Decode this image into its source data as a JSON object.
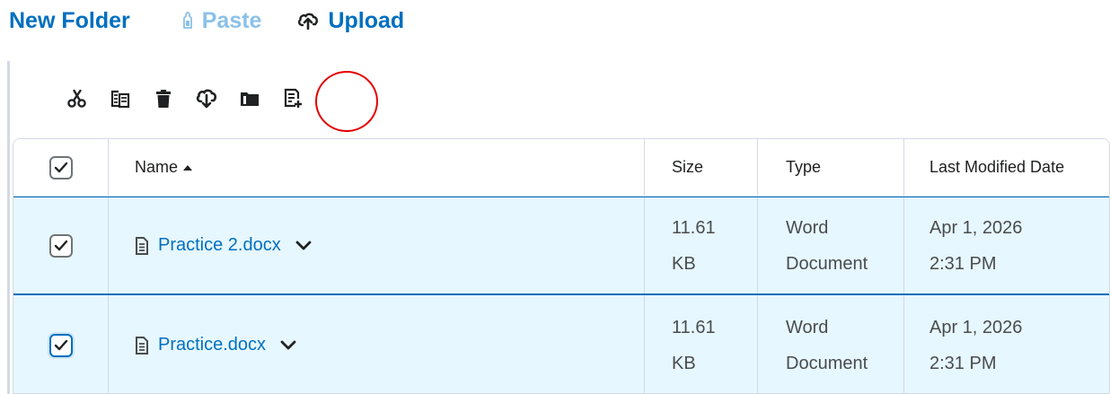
{
  "topbar": {
    "new_folder_label": "New Folder",
    "paste_label": "Paste",
    "upload_label": "Upload"
  },
  "toolbar": {
    "buttons": [
      {
        "icon": "scissors-icon",
        "action": "cut"
      },
      {
        "icon": "copy-icon",
        "action": "copy"
      },
      {
        "icon": "trash-icon",
        "action": "delete"
      },
      {
        "icon": "download-icon",
        "action": "download"
      },
      {
        "icon": "move-folder-icon",
        "action": "move"
      },
      {
        "icon": "add-to-document-icon",
        "action": "add-to-document",
        "highlighted": true
      }
    ]
  },
  "table": {
    "columns": {
      "name": "Name",
      "size": "Size",
      "type": "Type",
      "modified": "Last Modified Date"
    },
    "rows": [
      {
        "name": "Practice 2.docx",
        "size_line1": "11.61",
        "size_line2": "KB",
        "type_line1": "Word",
        "type_line2": "Document",
        "date_line1": "Apr 1, 2026",
        "date_line2": "2:31 PM",
        "checked": true
      },
      {
        "name": "Practice.docx",
        "size_line1": "11.61",
        "size_line2": "KB",
        "type_line1": "Word",
        "type_line2": "Document",
        "date_line1": "Apr 1, 2026",
        "date_line2": "2:31 PM",
        "checked": true
      }
    ]
  },
  "colors": {
    "accent": "#006fbf",
    "paste_disabled": "#8bc1e8",
    "selected_row_bg": "#e6f7ff",
    "highlight_ring": "#e30000"
  }
}
